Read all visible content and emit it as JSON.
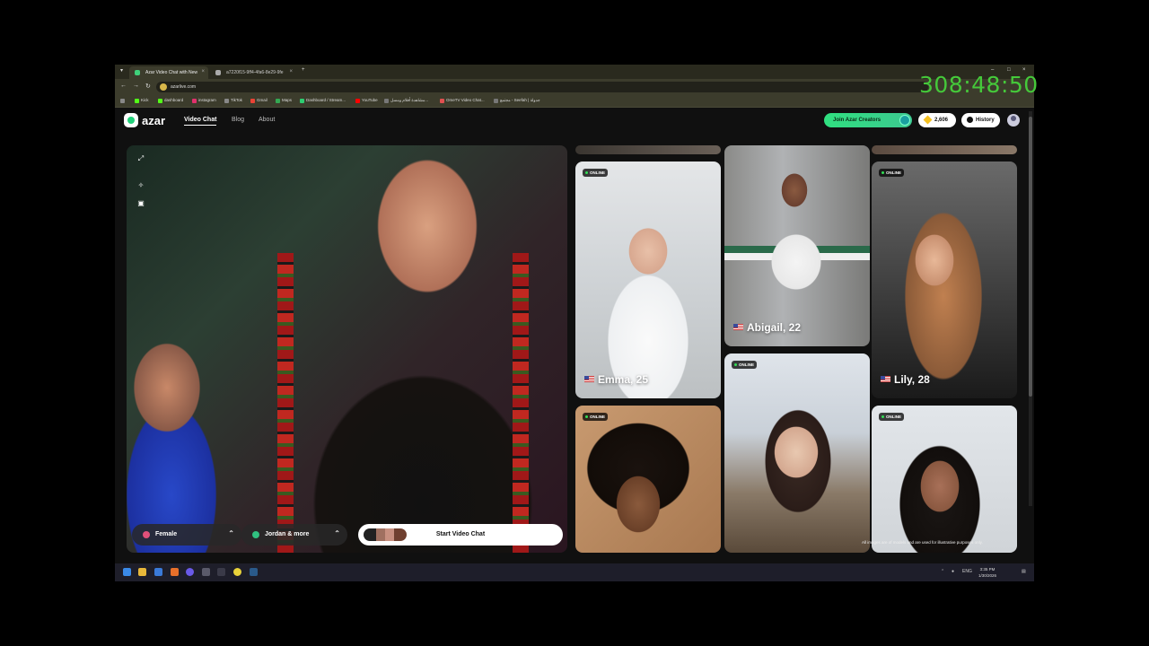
{
  "browser": {
    "tabs": [
      {
        "title": "Azar Video Chat with New"
      },
      {
        "title": "a7220f15-9ff4-4fa6-8e29-9fe"
      }
    ],
    "url": "azarlive.com",
    "bookmarks": [
      {
        "label": "Kick",
        "color": "#53fc18"
      },
      {
        "label": "dashboard",
        "color": "#53fc18"
      },
      {
        "label": "instagram",
        "color": "#e1306c"
      },
      {
        "label": "TikTok",
        "color": "#222222"
      },
      {
        "label": "Gmail",
        "color": "#ea4335"
      },
      {
        "label": "Maps",
        "color": "#34a853"
      },
      {
        "label": "Dashboard / Stream...",
        "color": "#2ecc71"
      },
      {
        "label": "YouTube",
        "color": "#ff0000"
      },
      {
        "label": "مشاهدة أفلام ومسل...",
        "color": "#777777"
      },
      {
        "label": "OmeTV Video Chat...",
        "color": "#e05050"
      },
      {
        "label": "مجتمع - Seefah | جدولة",
        "color": "#777777"
      }
    ]
  },
  "timer": "308:48:50",
  "site": {
    "logo": "azar",
    "nav": [
      "Video Chat",
      "Blog",
      "About"
    ],
    "join_label": "Join Azar Creators",
    "gems": "2,606",
    "history_label": "History"
  },
  "video": {
    "gender_filter": "Female",
    "region_filter": "Jordan & more",
    "start_label": "Start Video Chat"
  },
  "cards": [
    {
      "online": "ONLINE",
      "name": "Emma, 25"
    },
    {
      "online": "",
      "name": "Abigail, 22"
    },
    {
      "online": "ONLINE",
      "name": "Lily, 28"
    },
    {
      "online": "ONLINE",
      "name": ""
    },
    {
      "online": "ONLINE",
      "name": ""
    },
    {
      "online": "ONLINE",
      "name": ""
    }
  ],
  "disclaimer": "All images are of models and are used for illustrative purposes only.",
  "taskbar": {
    "lang": "ENG",
    "time": "3:35 PM",
    "date": "1/30/2026"
  }
}
